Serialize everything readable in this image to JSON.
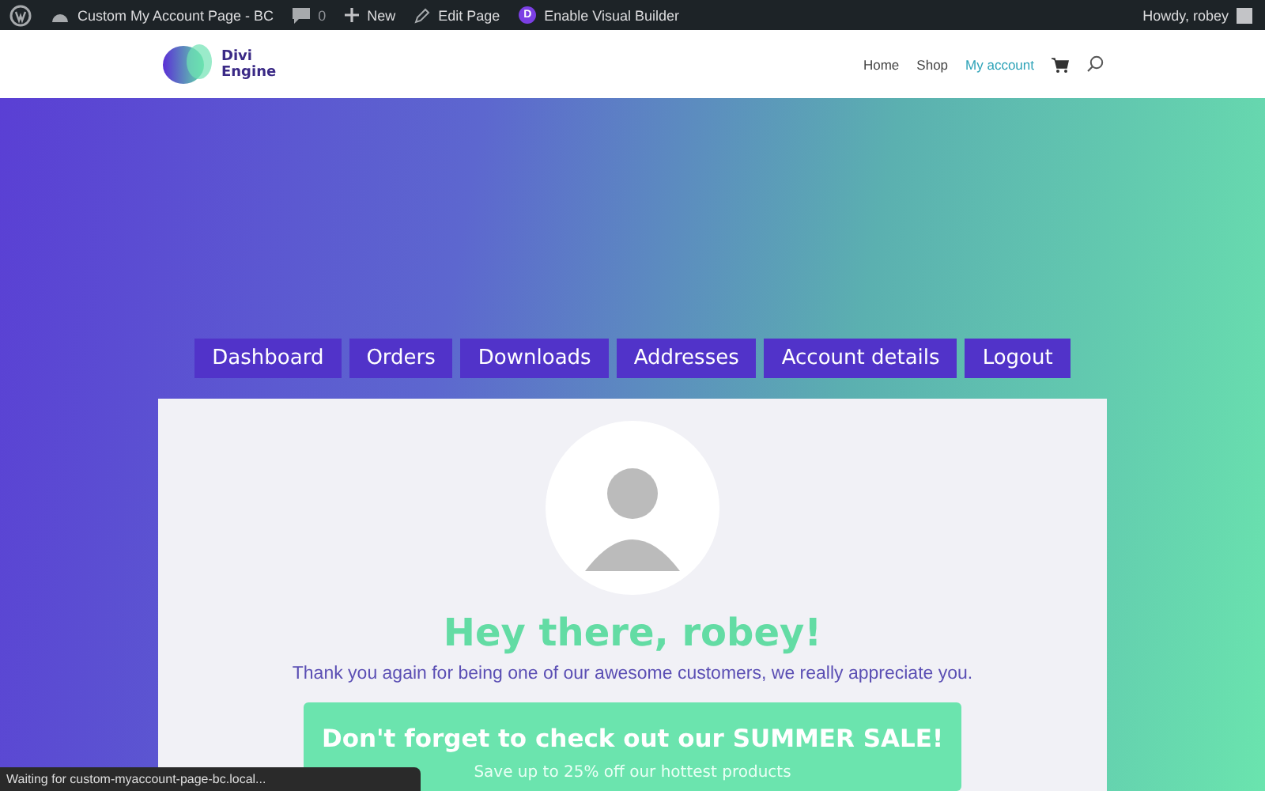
{
  "admin_bar": {
    "site": "Custom My Account Page - BC",
    "comments": "0",
    "new": "New",
    "edit": "Edit Page",
    "builder_badge": "D",
    "builder": "Enable Visual Builder",
    "greeting": "Howdy, robey"
  },
  "header": {
    "logo_text": [
      "Divi",
      "Engine"
    ],
    "nav": [
      {
        "label": "Home",
        "selected": false
      },
      {
        "label": "Shop",
        "selected": false
      },
      {
        "label": "My account",
        "selected": true
      }
    ]
  },
  "account_nav": [
    "Dashboard",
    "Orders",
    "Downloads",
    "Addresses",
    "Account details",
    "Logout"
  ],
  "card": {
    "greeting": "Hey there, robey!",
    "thanks": "Thank you again for being one of our awesome customers, we really appreciate you.",
    "promo": {
      "title": "Don't forget to check out our SUMMER SALE!",
      "subtitle": "Save up to 25% off our hottest products"
    }
  },
  "status_bar": "Waiting for custom-myaccount-page-bc.local..."
}
